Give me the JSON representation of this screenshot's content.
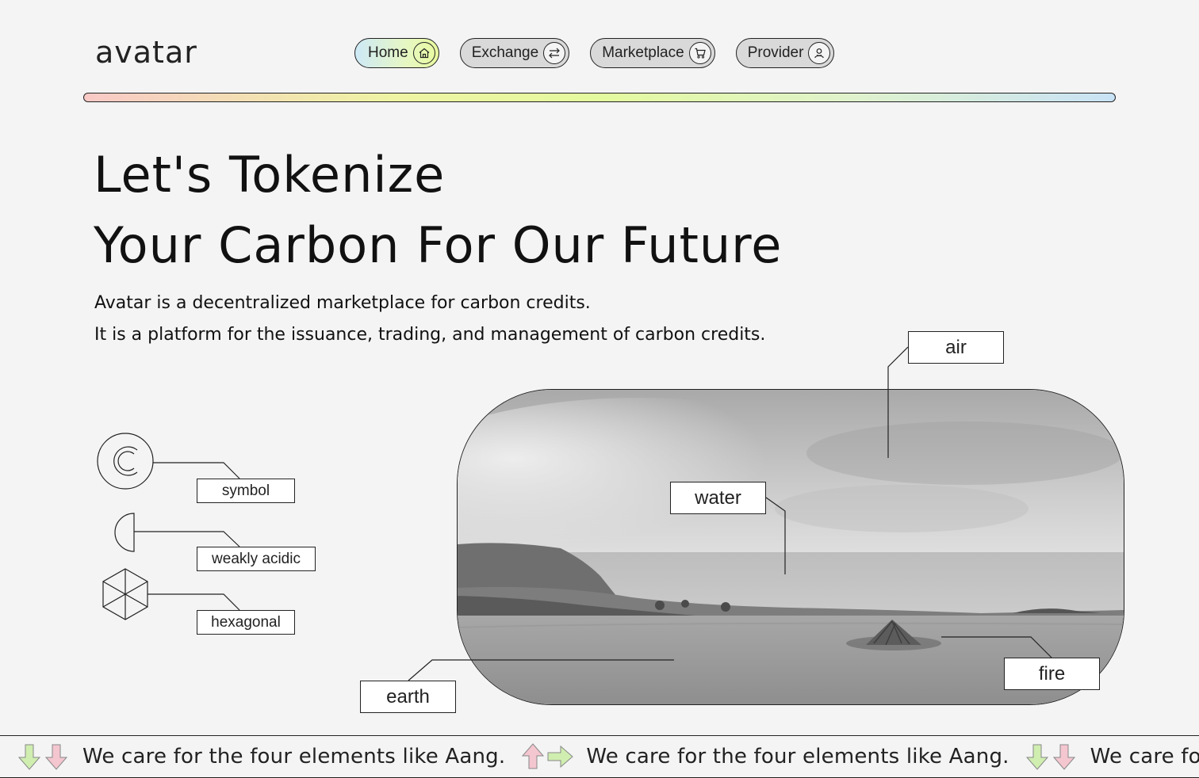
{
  "brand": {
    "logo": "avatar"
  },
  "nav": {
    "items": [
      {
        "label": "Home",
        "icon": "home-icon",
        "active": true
      },
      {
        "label": "Exchange",
        "icon": "exchange-icon",
        "active": false
      },
      {
        "label": "Marketplace",
        "icon": "cart-icon",
        "active": false
      },
      {
        "label": "Provider",
        "icon": "provider-icon",
        "active": false
      }
    ]
  },
  "hero": {
    "line1": "Let's Tokenize",
    "line2": "Your Carbon For Our Future",
    "desc1": "Avatar is a decentralized marketplace for carbon credits.",
    "desc2": "It is a platform for the issuance, trading, and management of carbon credits."
  },
  "features": [
    {
      "label": "symbol",
      "icon": "copyright-icon"
    },
    {
      "label": "weakly acidic",
      "icon": "half-circle-icon"
    },
    {
      "label": "hexagonal",
      "icon": "hexagon-icon"
    }
  ],
  "elements": {
    "air": "air",
    "water": "water",
    "earth": "earth",
    "fire": "fire"
  },
  "ticker": {
    "text": "We care for the four elements like Aang.",
    "colors": {
      "green": "#cfeeb0",
      "pink": "#f4c6cf"
    }
  },
  "colors": {
    "background": "#f4f4f4",
    "ink": "#111111",
    "gradient": [
      "#f9c9c6",
      "#e4fa9e",
      "#c8e2f6"
    ]
  }
}
